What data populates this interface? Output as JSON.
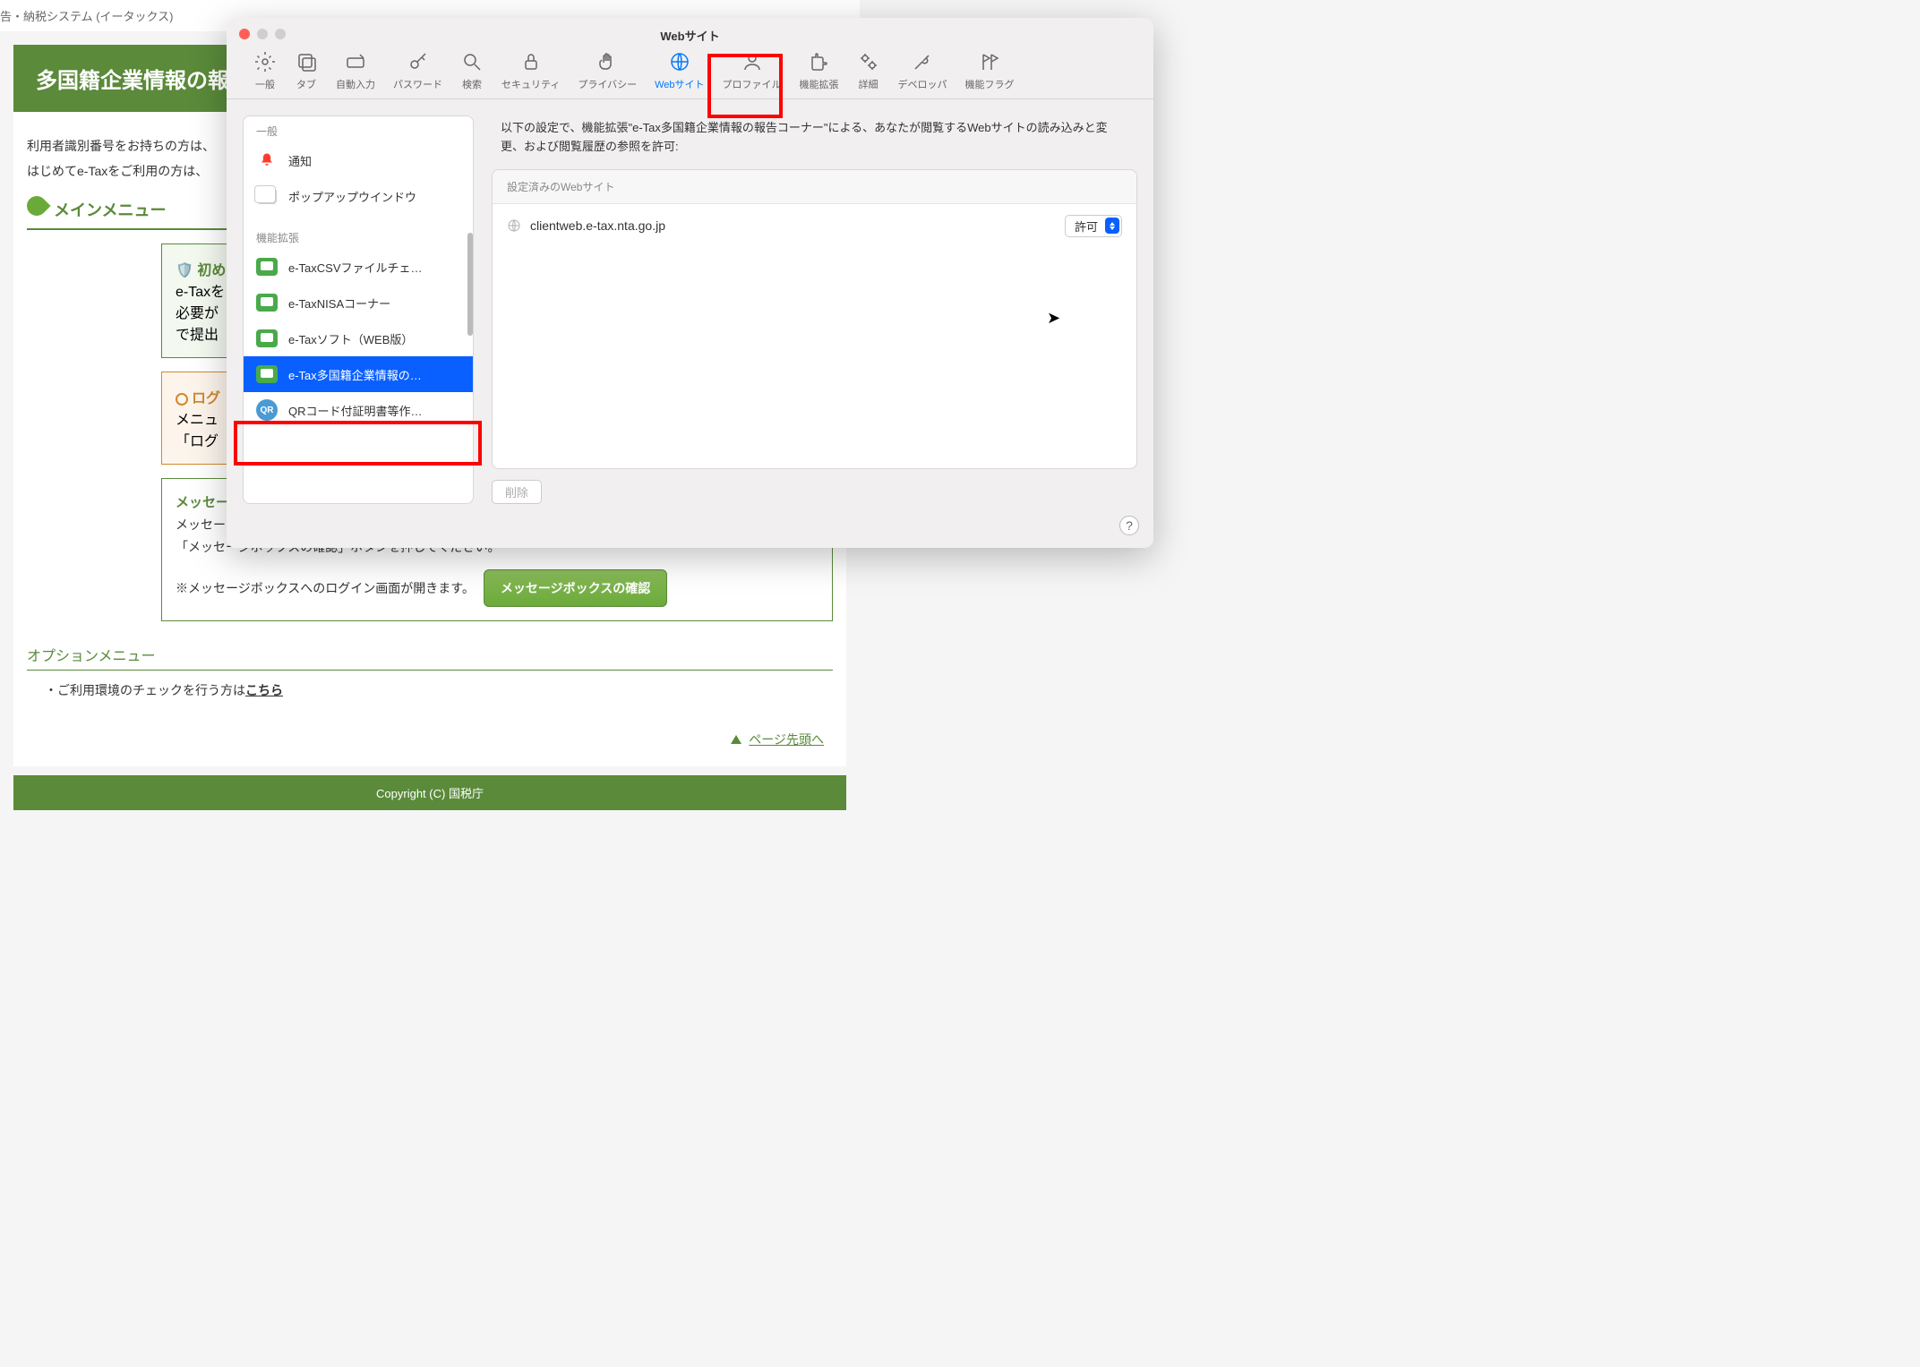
{
  "bg": {
    "header": "告・納税システム (イータックス)",
    "banner": "多国籍企業情報の報",
    "para1": "利用者識別番号をお持ちの方は、",
    "para2": "はじめてe-Taxをご利用の方は、",
    "main_menu": "メインメニュー",
    "box1_title": "初め",
    "box1_l1": "e-Taxを",
    "box1_l2": "必要が",
    "box1_l3": "で提出",
    "box2_title": "ログ",
    "box2_l1": "メニュ",
    "box2_l2": "「ログ",
    "box3_title": "メッセージボックスの内容を確認される方へ",
    "box3_l1": "メッセージボックスに格納された受信通知の確認を行うことができます。",
    "box3_l2": "「メッセージボックスの確認」ボタンを押してください。",
    "box3_l3": "※メッセージボックスへのログイン画面が開きます。",
    "confirm_btn": "メッセージボックスの確認",
    "opt_menu": "オプションメニュー",
    "opt_item": "・ご利用環境のチェックを行う方は",
    "opt_link": "こちら",
    "page_top": "ページ先頭へ",
    "footer": "Copyright (C) 国税庁"
  },
  "prefs": {
    "title": "Webサイト",
    "toolbar": {
      "general": "一般",
      "tabs": "タブ",
      "autofill": "自動入力",
      "passwords": "パスワード",
      "search": "検索",
      "security": "セキュリティ",
      "privacy": "プライバシー",
      "websites": "Webサイト",
      "profiles": "プロファイル",
      "extensions": "機能拡張",
      "advanced": "詳細",
      "developer": "デベロッパ",
      "flags": "機能フラグ"
    },
    "sidebar": {
      "general_section": "一般",
      "notifications": "通知",
      "popups": "ポップアップウインドウ",
      "ext_section": "機能拡張",
      "ext1": "e-TaxCSVファイルチェ…",
      "ext2": "e-TaxNISAコーナー",
      "ext3": "e-Taxソフト（WEB版）",
      "ext4": "e-Tax多国籍企業情報の…",
      "ext5": "QRコード付証明書等作…"
    },
    "main": {
      "desc": "以下の設定で、機能拡張\"e-Tax多国籍企業情報の報告コーナー\"による、あなたが閲覧するWebサイトの読み込みと変更、および閲覧履歴の参照を許可:",
      "configured_header": "設定済みのWebサイト",
      "site1": "clientweb.e-tax.nta.go.jp",
      "permission": "許可",
      "delete": "削除"
    },
    "help": "?"
  }
}
